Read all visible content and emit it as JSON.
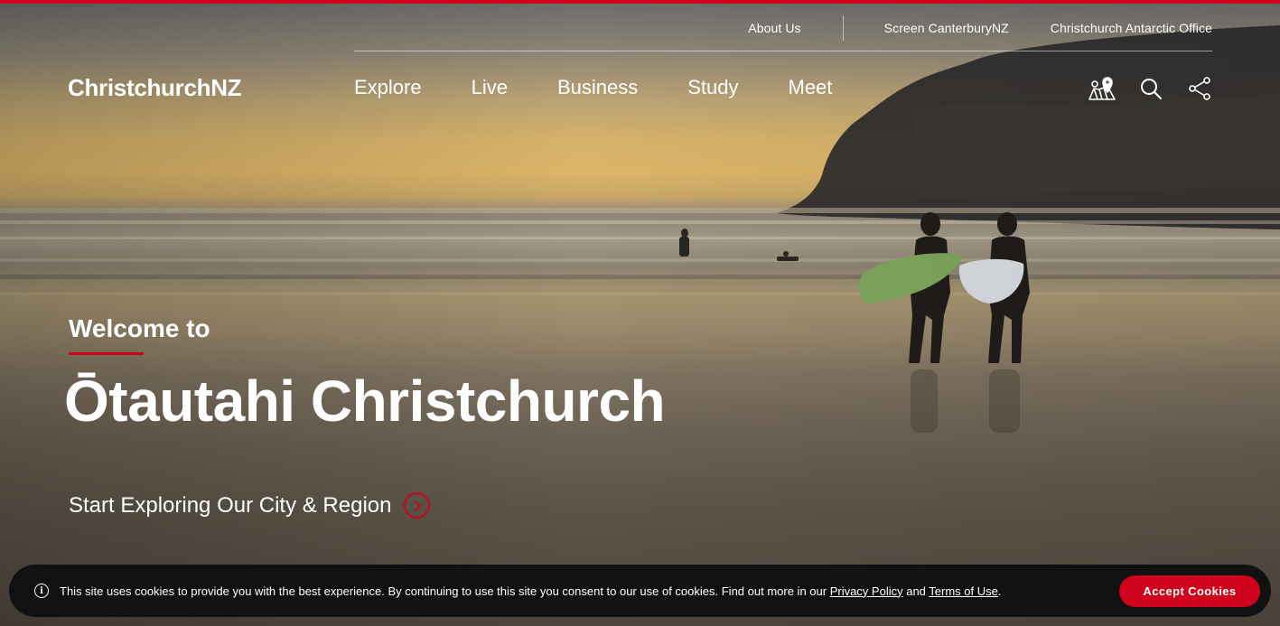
{
  "utility_nav": {
    "about": "About Us",
    "screen": "Screen CanterburyNZ",
    "antarctic": "Christchurch Antarctic Office"
  },
  "header": {
    "logo": "ChristchurchNZ",
    "nav": [
      "Explore",
      "Live",
      "Business",
      "Study",
      "Meet"
    ],
    "icons": [
      "map-pin-icon",
      "search-icon",
      "share-icon"
    ]
  },
  "hero": {
    "welcome": "Welcome to",
    "headline": "Ōtautahi Christchurch",
    "cta": "Start Exploring Our City & Region"
  },
  "cookie_banner": {
    "text_before": "This site uses cookies to provide you with the best experience. By continuing to use this site you consent to our use of cookies. Find out more in our ",
    "privacy_link": "Privacy Policy",
    "and": " and ",
    "terms_link": "Terms of Use",
    "period": ".",
    "accept": "Accept Cookies"
  },
  "colors": {
    "accent": "#d0021b",
    "banner": "#111111",
    "text": "#ffffff"
  }
}
